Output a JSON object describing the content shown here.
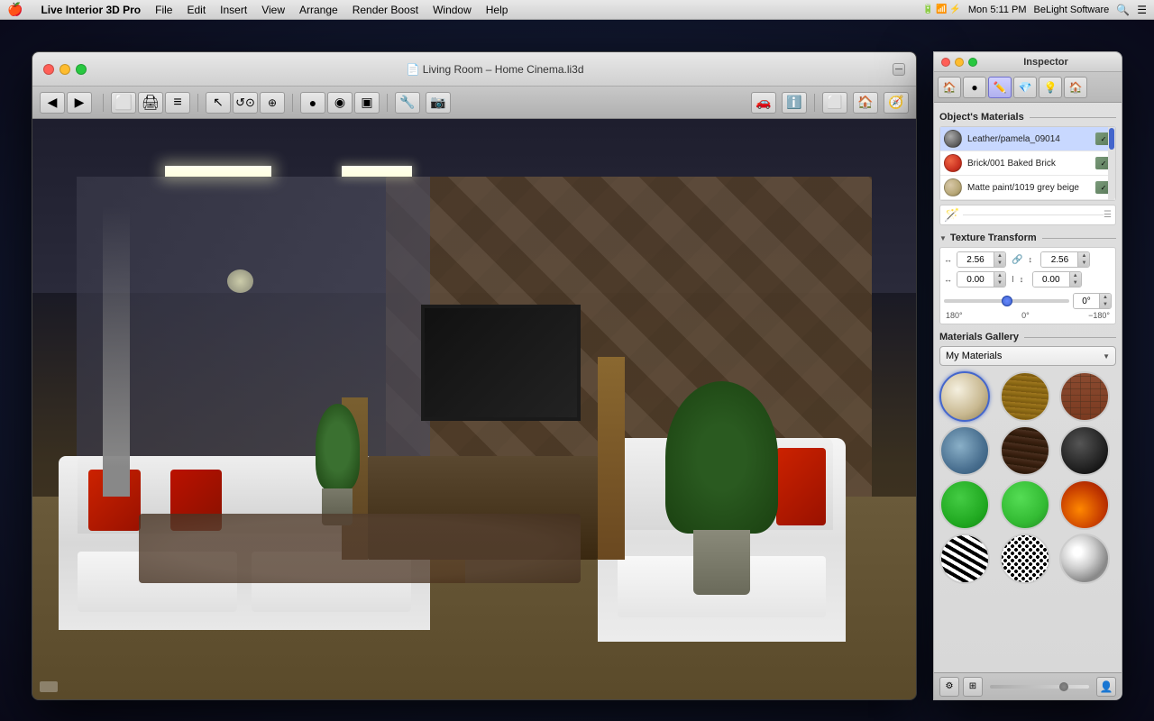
{
  "menubar": {
    "apple": "🍎",
    "items": [
      {
        "label": "Live Interior 3D Pro"
      },
      {
        "label": "File"
      },
      {
        "label": "Edit"
      },
      {
        "label": "Insert"
      },
      {
        "label": "View"
      },
      {
        "label": "Arrange"
      },
      {
        "label": "Render Boost"
      },
      {
        "label": "Window"
      },
      {
        "label": "Help"
      }
    ],
    "right": {
      "time": "Mon 5:11 PM",
      "company": "BeLight Software"
    }
  },
  "main_window": {
    "title": "Living Room – Home Cinema.li3d",
    "expand_btn": "—"
  },
  "inspector": {
    "title": "Inspector",
    "tabs": [
      {
        "icon": "🏠",
        "label": "home"
      },
      {
        "icon": "●",
        "label": "sphere"
      },
      {
        "icon": "✏️",
        "label": "edit"
      },
      {
        "icon": "💎",
        "label": "gem"
      },
      {
        "icon": "💡",
        "label": "light"
      },
      {
        "icon": "🏠",
        "label": "house2"
      }
    ],
    "objects_materials_title": "Object's Materials",
    "materials": [
      {
        "name": "Leather/pamela_09014",
        "swatch_color": "#888888"
      },
      {
        "name": "Brick/001 Baked Brick",
        "swatch_color": "#cc4422"
      },
      {
        "name": "Matte paint/1019 grey beige",
        "swatch_color": "#c8b898"
      }
    ],
    "texture_transform": {
      "title": "Texture Transform",
      "x_scale": "2.56",
      "y_scale": "2.56",
      "x_offset": "0.00",
      "y_offset": "0.00",
      "rotation": "0°",
      "label_180": "180°",
      "label_0": "0°",
      "label_neg180": "−180°"
    },
    "gallery": {
      "title": "Materials Gallery",
      "dropdown_label": "My Materials",
      "materials": [
        {
          "id": "cream",
          "class": "mat-cream"
        },
        {
          "id": "wood-light",
          "class": "mat-wood-light"
        },
        {
          "id": "brick",
          "class": "mat-brick"
        },
        {
          "id": "water",
          "class": "mat-water"
        },
        {
          "id": "dark-wood",
          "class": "mat-dark-wood"
        },
        {
          "id": "black",
          "class": "mat-black"
        },
        {
          "id": "green1",
          "class": "mat-green1"
        },
        {
          "id": "green2",
          "class": "mat-green2"
        },
        {
          "id": "fire",
          "class": "mat-fire"
        },
        {
          "id": "zebra",
          "class": "mat-zebra"
        },
        {
          "id": "spots",
          "class": "mat-spots"
        },
        {
          "id": "chrome",
          "class": "mat-chrome"
        }
      ]
    }
  },
  "toolbar": {
    "back_label": "◀",
    "forward_label": "▶",
    "buttons": [
      "📐",
      "🖨",
      "≡",
      "▶",
      "⊙",
      "◎",
      "▣",
      "📷",
      "🔧",
      "ℹ️",
      "⬜",
      "🏠",
      "🏠"
    ]
  }
}
